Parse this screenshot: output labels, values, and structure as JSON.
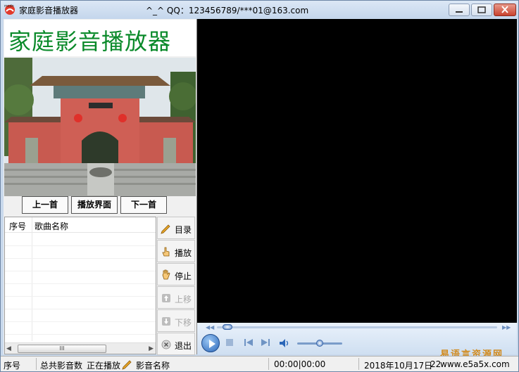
{
  "window": {
    "title": "家庭影音播放器",
    "qq_text": "^_^  QQ：123456789/***01@163.com",
    "app_icon_label": "msdn",
    "minimize_icon": "minimize-icon",
    "maximize_icon": "maximize-icon",
    "close_icon": "close-icon"
  },
  "banner": {
    "title": "家庭影音播放器"
  },
  "nav": {
    "prev": "上一首",
    "player_view": "播放界面",
    "next": "下一首"
  },
  "playlist": {
    "headers": [
      "序号",
      "歌曲名称"
    ],
    "rows": [],
    "scroll_thumb": "III"
  },
  "side_buttons": [
    {
      "label": "目录",
      "icon": "pencil-icon",
      "enabled": true
    },
    {
      "label": "播放",
      "icon": "hand-pointer-icon",
      "enabled": true
    },
    {
      "label": "停止",
      "icon": "hand-stop-icon",
      "enabled": true
    },
    {
      "label": "上移",
      "icon": "move-up-icon",
      "enabled": false
    },
    {
      "label": "下移",
      "icon": "move-down-icon",
      "enabled": false
    },
    {
      "label": "退出",
      "icon": "exit-icon",
      "enabled": true
    }
  ],
  "player": {
    "seek_progress": 0.02,
    "volume": 0.5
  },
  "statusbar": {
    "seq": "序号",
    "total": "总共影音数",
    "playing": "正在播放",
    "media_name": "影音名称",
    "time": "00:00|00:00",
    "date": "2018年10月17日",
    "time_partial": "22"
  },
  "watermark": {
    "brand": "易语言资源网",
    "url": "www.e5a5x.com"
  },
  "colors": {
    "banner_green": "#0a8a2a",
    "video_bg": "#000000",
    "watermark": "#d28a1c"
  }
}
